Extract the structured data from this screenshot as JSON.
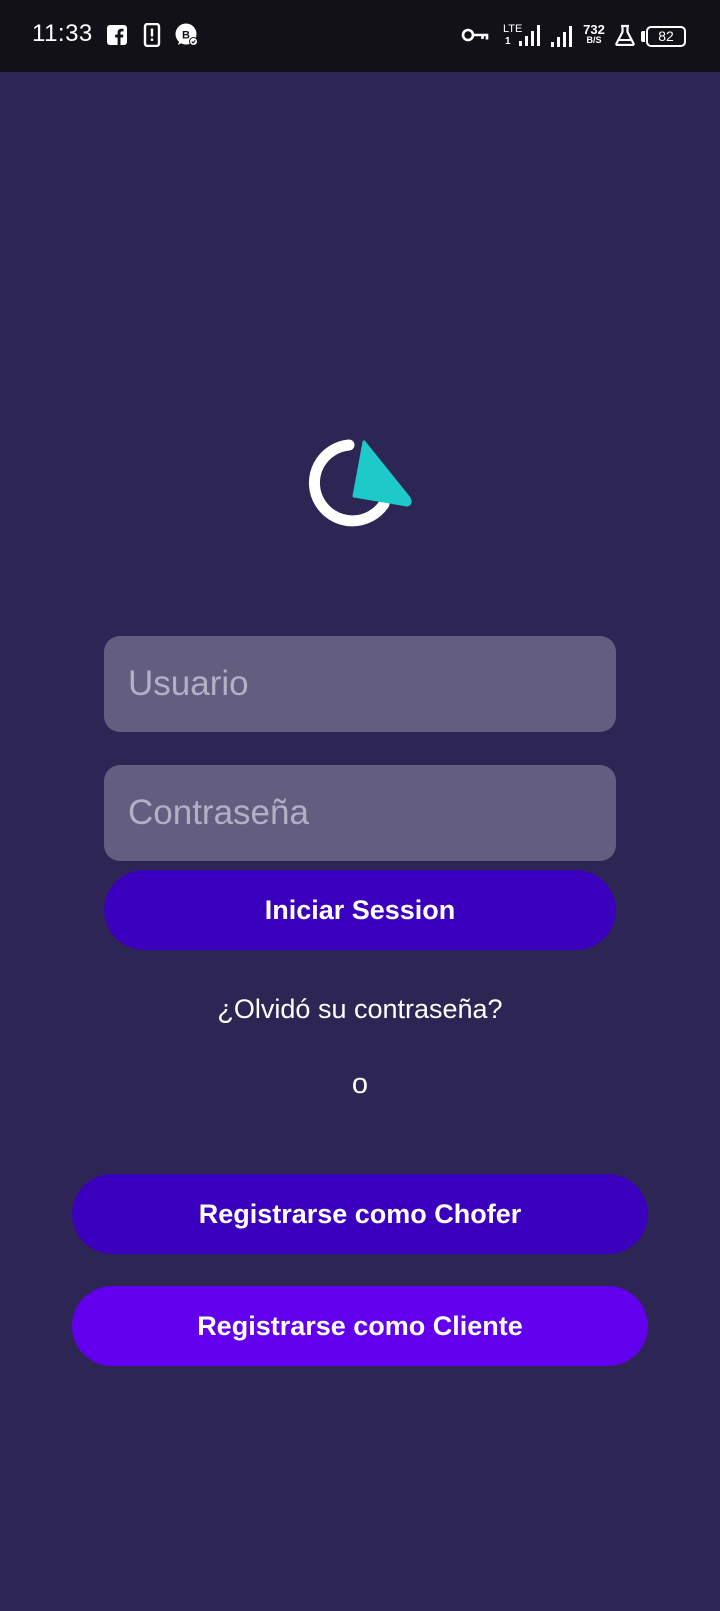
{
  "status_bar": {
    "time": "11:33",
    "left_icons": [
      "facebook-icon",
      "alert-icon",
      "whatsapp-business-icon"
    ],
    "right_icons": [
      "vpn-key-icon",
      "lte-signal-icon",
      "signal-icon",
      "lab-icon"
    ],
    "network_type": "LTE",
    "network_sub": "1",
    "net_speed": "732",
    "net_speed_unit": "B/S",
    "battery": "82"
  },
  "logo": {
    "icon": "app-logo-icon",
    "colors": {
      "ring": "#ffffff",
      "arrow": "#1ec9c9"
    }
  },
  "form": {
    "username_placeholder": "Usuario",
    "password_placeholder": "Contraseña",
    "login_label": "Iniciar Session",
    "forgot_label": "¿Olvidó su contraseña?",
    "separator": "o"
  },
  "register": {
    "driver_label": "Registrarse como Chofer",
    "client_label": "Registrarse como Cliente"
  },
  "colors": {
    "background": "#2d2654",
    "status_bar": "#131118",
    "input": "#635e80",
    "primary_dark": "#3a00bd",
    "primary": "#6200ee"
  }
}
